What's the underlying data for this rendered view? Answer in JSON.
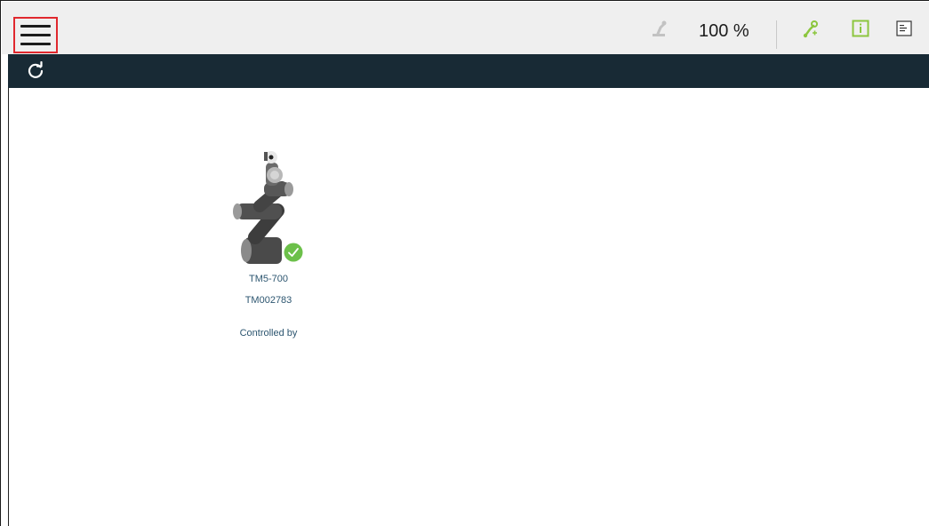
{
  "toolbar": {
    "menu_icon": "hamburger-menu-icon",
    "zoom_text": "100 %",
    "icons": [
      "robot-arm-icon",
      "network-robot-icon",
      "info-icon",
      "log-icon"
    ]
  },
  "navbar": {
    "refresh_icon": "refresh-icon"
  },
  "robot": {
    "model": "TM5-700",
    "serial": "TM002783",
    "controlled_by_label": "Controlled by",
    "status_icon": "check-badge-icon",
    "status_color": "#6cc04a"
  },
  "colors": {
    "navbar_bg": "#182a35",
    "toolbar_bg": "#efefef",
    "highlight_border": "#e0282e",
    "accent_green": "#8cc63f"
  }
}
